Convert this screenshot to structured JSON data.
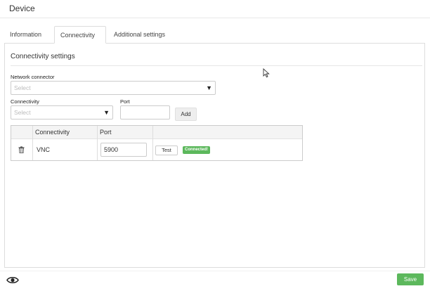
{
  "header": {
    "title": "Device"
  },
  "tabs": [
    {
      "label": "Information"
    },
    {
      "label": "Connectivity"
    },
    {
      "label": "Additional settings"
    }
  ],
  "active_tab": "Connectivity",
  "section": {
    "title": "Connectivity settings"
  },
  "network_connector": {
    "label": "Network connector",
    "placeholder": "Select"
  },
  "connectivity": {
    "label": "Connectivity",
    "placeholder": "Select"
  },
  "port": {
    "label": "Port",
    "value": ""
  },
  "add_button": "Add",
  "table": {
    "columns": [
      "Connectivity",
      "Port"
    ],
    "rows": [
      {
        "connectivity": "VNC",
        "port": "5900",
        "test_label": "Test",
        "status": "Connected!"
      }
    ]
  },
  "footer": {
    "save_label": "Save"
  },
  "icons": {
    "delete": "trash-icon",
    "view": "eye-icon",
    "dropdown": "caret-down-icon",
    "pointer": "mouse-cursor-icon"
  },
  "colors": {
    "success": "#5cb85c",
    "border": "#dddddd",
    "header_bg": "#f4f4f4"
  }
}
